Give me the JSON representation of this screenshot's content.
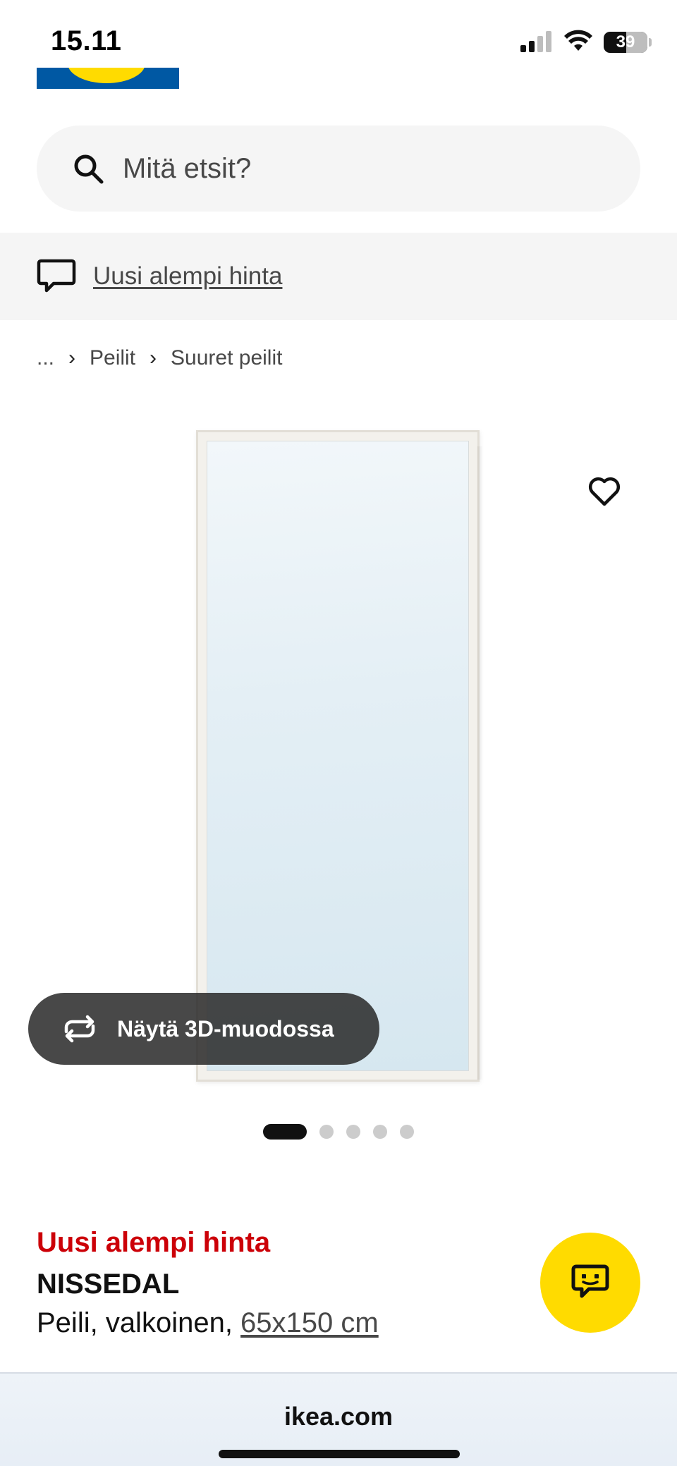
{
  "status_bar": {
    "time": "15.11",
    "battery": "39",
    "icons": [
      "signal-icon",
      "wifi-icon",
      "battery-icon"
    ]
  },
  "search": {
    "placeholder": "Mitä etsit?",
    "icon": "search-icon"
  },
  "promo": {
    "icon": "speech-bubble-icon",
    "label": "Uusi alempi hinta"
  },
  "breadcrumb": {
    "items": [
      "...",
      "Peilit",
      "Suuret peilit"
    ],
    "separator": "›"
  },
  "gallery": {
    "favorite_icon": "heart-icon",
    "view_3d_label": "Näytä 3D-muodossa",
    "view_3d_icon": "rotate-3d-icon",
    "image_count": 5,
    "active_index": 0
  },
  "product": {
    "price_badge": "Uusi alempi hinta",
    "name": "NISSEDAL",
    "description_prefix": "Peili, valkoinen, ",
    "size": "65x150 cm"
  },
  "chat": {
    "icon": "chat-bot-icon"
  },
  "browser": {
    "url": "ikea.com"
  },
  "colors": {
    "ikea_blue": "#0058a3",
    "ikea_yellow": "#ffdb00",
    "price_red": "#cc0008"
  }
}
